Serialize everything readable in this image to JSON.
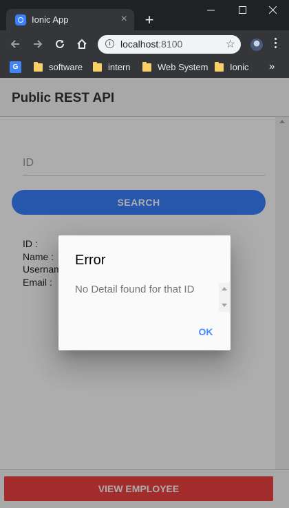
{
  "browser": {
    "tab_title": "Ionic App",
    "tab_close": "×",
    "new_tab": "+",
    "url_host": "localhost",
    "url_port": ":8100",
    "bookmarks": [
      {
        "label": "software"
      },
      {
        "label": "intern"
      },
      {
        "label": "Web System"
      },
      {
        "label": "Ionic"
      }
    ],
    "bookmarks_overflow": "»"
  },
  "app": {
    "header_title": "Public REST API",
    "id_placeholder": "ID",
    "search_label": "SEARCH",
    "details": {
      "id_label": "ID :",
      "name_label": "Name :",
      "username_label": "Username :",
      "email_label": "Email :"
    },
    "view_employee_label": "VIEW EMPLOYEE"
  },
  "alert": {
    "title": "Error",
    "message": "No Detail found for that ID",
    "ok_label": "OK"
  },
  "colors": {
    "primary": "#3880ff",
    "danger": "#f04141",
    "alert_button": "#488aff"
  }
}
